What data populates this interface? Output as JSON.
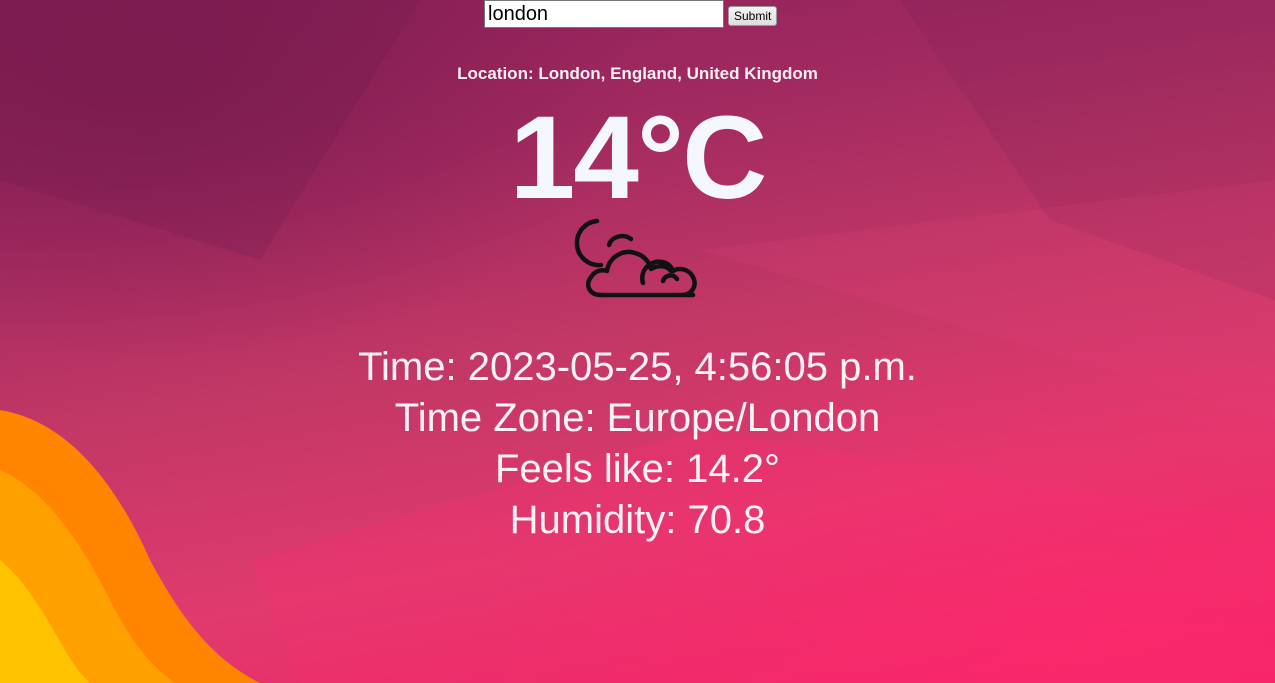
{
  "search": {
    "value": "london",
    "submit_label": "Submit"
  },
  "weather": {
    "location_text": "Location: London, England, United Kingdom",
    "temperature_text": "14°C",
    "icon": "cloudy-night-icon",
    "time_text": "Time: 2023-05-25, 4:56:05 p.m.",
    "timezone_text": "Time Zone: Europe/London",
    "feels_like_text": "Feels like: 14.2°",
    "humidity_text": "Humidity: 70.8"
  },
  "colors": {
    "background_top": "#8a2058",
    "background_bottom": "#f21f63",
    "accent_orange": "#ff8a00",
    "accent_yellow": "#ffc400",
    "text": "#ffffff",
    "icon_stroke": "#111111"
  }
}
